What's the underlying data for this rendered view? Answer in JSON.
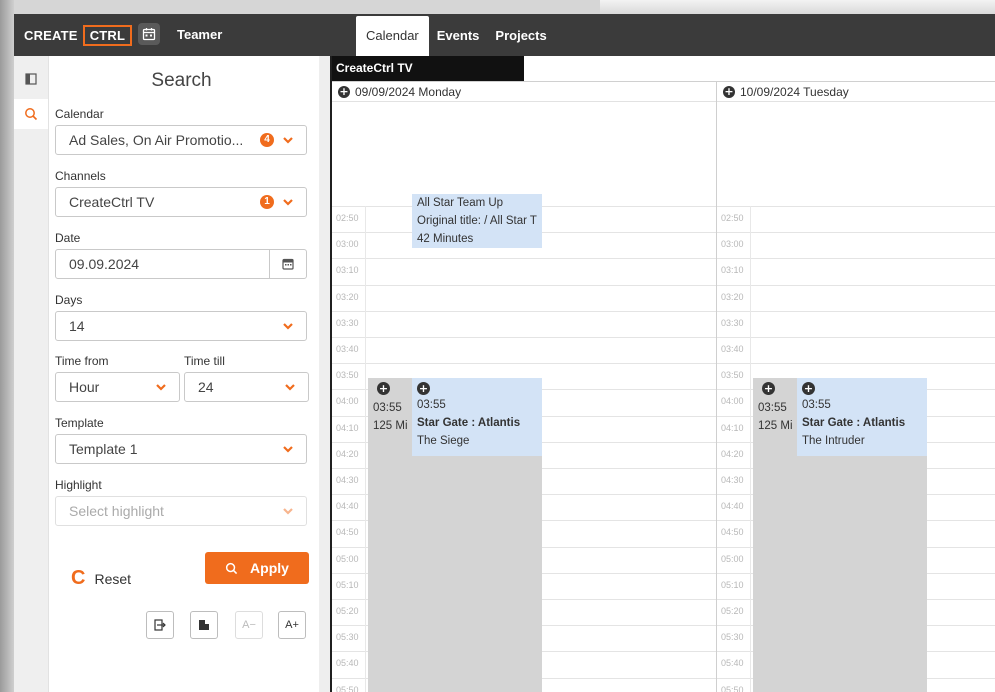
{
  "topbar": {
    "brand_prefix": "CREATE",
    "brand_boxed": "CTRL",
    "app_name": "Teamer",
    "tabs": [
      "Calendar",
      "Events",
      "Projects"
    ]
  },
  "search": {
    "title": "Search",
    "calendar_label": "Calendar",
    "calendar_value": "Ad Sales, On Air Promotio...",
    "calendar_badge": "4",
    "channels_label": "Channels",
    "channels_value": "CreateCtrl TV",
    "channels_badge": "1",
    "date_label": "Date",
    "date_value": "09.09.2024",
    "days_label": "Days",
    "days_value": "14",
    "time_from_label": "Time from",
    "time_from_value": "Hour",
    "time_till_label": "Time till",
    "time_till_value": "24",
    "template_label": "Template",
    "template_value": "Template 1",
    "highlight_label": "Highlight",
    "highlight_placeholder": "Select highlight",
    "reset_label": "Reset",
    "apply_label": "Apply",
    "font_decrease": "A−",
    "font_increase": "A+"
  },
  "calendar": {
    "channel": "CreateCtrl TV",
    "days": [
      {
        "label": "09/09/2024 Monday"
      },
      {
        "label": "10/09/2024 Tuesday"
      }
    ],
    "times": [
      "02:50",
      "03:00",
      "03:10",
      "03:20",
      "03:30",
      "03:40",
      "03:50",
      "04:00",
      "04:10",
      "04:20",
      "04:30",
      "04:40",
      "04:50",
      "05:00",
      "05:10",
      "05:20",
      "05:30",
      "05:40",
      "05:50"
    ],
    "all_star": {
      "line1": "All Star Team Up",
      "line2": "Original title: / All Star T",
      "line3": "42 Minutes"
    },
    "monday": {
      "left_time": "03:55",
      "left_duration": "125 Mi",
      "event_time": "03:55",
      "event_title": "Star Gate : Atlantis",
      "event_episode": "The Siege"
    },
    "tuesday": {
      "left_time": "03:55",
      "left_duration": "125 Mi",
      "event_time": "03:55",
      "event_title": "Star Gate : Atlantis",
      "event_episode": "The Intruder"
    }
  }
}
